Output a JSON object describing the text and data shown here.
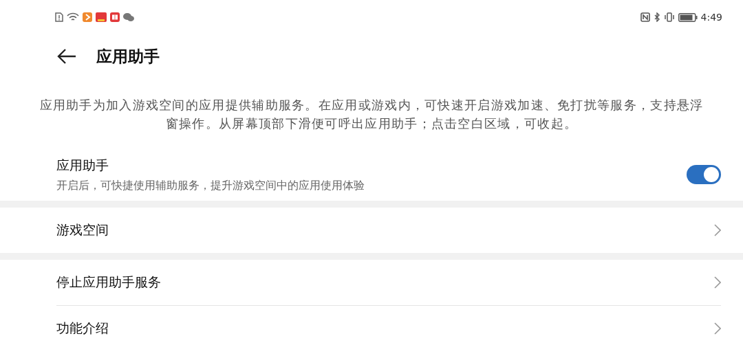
{
  "status_bar": {
    "time": "4:49"
  },
  "header": {
    "title": "应用助手"
  },
  "description": "应用助手为加入游戏空间的应用提供辅助服务。在应用或游戏内，可快速开启游戏加速、免打扰等服务，支持悬浮窗操作。从屏幕顶部下滑便可呼出应用助手；点击空白区域，可收起。",
  "sections": [
    [
      {
        "kind": "toggle",
        "title": "应用助手",
        "subtitle": "开启后，可快捷使用辅助服务，提升游戏空间中的应用使用体验",
        "on": true
      }
    ],
    [
      {
        "kind": "link",
        "title": "游戏空间"
      }
    ],
    [
      {
        "kind": "link",
        "title": "停止应用助手服务"
      },
      {
        "kind": "link",
        "title": "功能介绍"
      }
    ]
  ]
}
